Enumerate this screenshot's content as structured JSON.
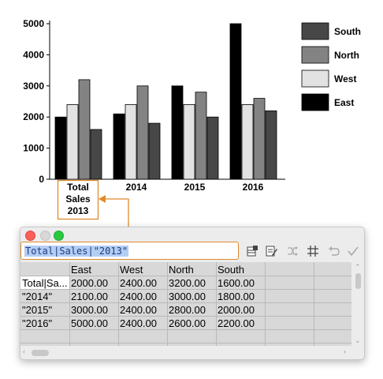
{
  "chart_data": {
    "type": "bar",
    "categories": [
      "Total\nSales\n2013",
      "2014",
      "2015",
      "2016"
    ],
    "series": [
      {
        "name": "East",
        "color": "#000000",
        "values": [
          2000,
          2100,
          3000,
          5000
        ]
      },
      {
        "name": "West",
        "color": "#e2e2e2",
        "values": [
          2400,
          2400,
          2400,
          2400
        ]
      },
      {
        "name": "North",
        "color": "#838383",
        "values": [
          3200,
          3000,
          2800,
          2600
        ]
      },
      {
        "name": "South",
        "color": "#474747",
        "values": [
          1600,
          1800,
          2000,
          2200
        ]
      }
    ],
    "legend_order": [
      "South",
      "North",
      "West",
      "East"
    ],
    "yticks": [
      0,
      1000,
      2000,
      3000,
      4000,
      5000
    ],
    "ylim": [
      0,
      5000
    ],
    "legend_position": "right",
    "grid": false
  },
  "spreadsheet": {
    "formula": "Total|Sales|\"2013\"",
    "headers": [
      "",
      "East",
      "West",
      "North",
      "South"
    ],
    "rows": [
      [
        "Total|Sa...",
        "2000.00",
        "2400.00",
        "3200.00",
        "1600.00"
      ],
      [
        "\"2014\"",
        "2100.00",
        "2400.00",
        "3000.00",
        "1800.00"
      ],
      [
        "\"2015\"",
        "3000.00",
        "2400.00",
        "2800.00",
        "2000.00"
      ],
      [
        "\"2016\"",
        "5000.00",
        "2400.00",
        "2600.00",
        "2200.00"
      ]
    ],
    "toolbar_icons": [
      "insert-row-icon",
      "edit-cells-icon",
      "shuffle-icon",
      "grid-icon",
      "undo-icon",
      "checkmark-icon"
    ]
  },
  "colors": {
    "highlight": "#e08a2c",
    "selection": "#b4cef3"
  }
}
